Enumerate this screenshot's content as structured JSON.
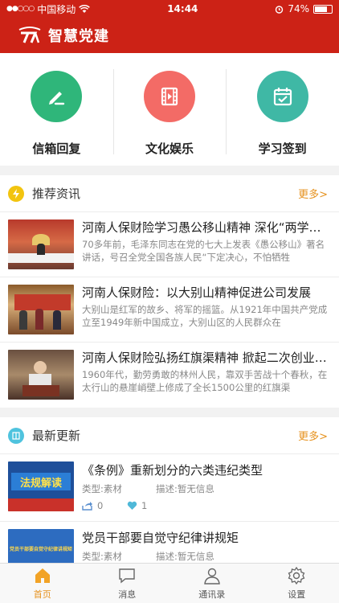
{
  "status_bar": {
    "carrier": "中国移动",
    "time": "14:44",
    "battery": "74%",
    "battery_level": 0.74
  },
  "header": {
    "title": "智慧党建"
  },
  "quick_actions": [
    {
      "label": "信箱回复",
      "icon": "pencil-icon",
      "color": "#2fb67a"
    },
    {
      "label": "文化娱乐",
      "icon": "film-icon",
      "color": "#f36b66"
    },
    {
      "label": "学习签到",
      "icon": "calendar-check-icon",
      "color": "#3fb8a5"
    }
  ],
  "recommended": {
    "title": "推荐资讯",
    "more": "更多>",
    "items": [
      {
        "title": "河南人保财险学习愚公移山精神 深化“两学一做”",
        "summary": "70多年前，毛泽东同志在党的七大上发表《愚公移山》著名讲话，号召全党全国各族人民“下定决心，不怕牺牲"
      },
      {
        "title": "河南人保财险：以大别山精神促进公司发展",
        "summary": "大别山是红军的故乡、将军的摇篮。从1921年中国共产党成立至1949年新中国成立，大别山区的人民群众在"
      },
      {
        "title": "河南人保财险弘扬红旗渠精神 掀起二次创业热潮",
        "summary": "1960年代，勤劳勇敢的林州人民，靠双手苦战十个春秋，在太行山的悬崖峭壁上修成了全长1500公里的红旗渠"
      }
    ]
  },
  "latest": {
    "title": "最新更新",
    "more": "更多>",
    "items": [
      {
        "title": "《条例》重新划分的六类违纪类型",
        "type": "类型:素材",
        "desc": "描述:暂无信息",
        "shares": "0",
        "likes": "1",
        "thumb_text": "法规解读"
      },
      {
        "title": "党员干部要自觉守纪律讲规矩",
        "type": "类型:素材",
        "desc": "描述:暂无信息",
        "thumb_text": "党员干部要自觉守纪律讲规矩"
      }
    ]
  },
  "tabs": [
    {
      "label": "首页",
      "icon": "home-icon",
      "active": true
    },
    {
      "label": "消息",
      "icon": "chat-icon",
      "active": false
    },
    {
      "label": "通讯录",
      "icon": "contacts-icon",
      "active": false
    },
    {
      "label": "设置",
      "icon": "gear-icon",
      "active": false
    }
  ]
}
